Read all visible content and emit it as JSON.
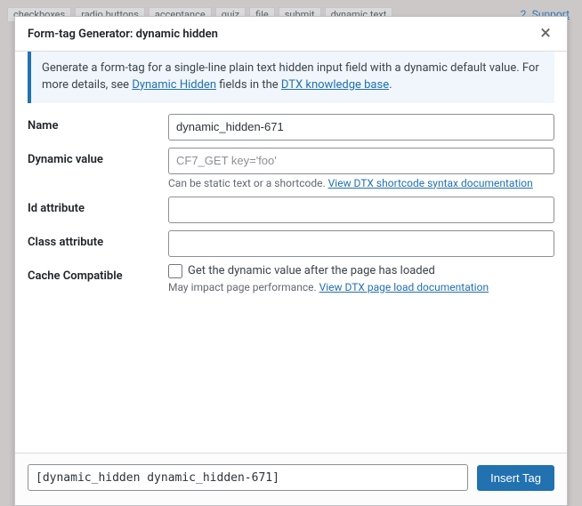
{
  "bg": {
    "tabs": [
      "checkboxes",
      "radio buttons",
      "acceptance",
      "quiz",
      "file",
      "submit",
      "dynamic text"
    ],
    "support_link": "2. Support"
  },
  "modal": {
    "title": "Form-tag Generator: dynamic hidden",
    "notice": {
      "text_before": "Generate a form-tag for a single-line plain text hidden input field with a dynamic default value. For more details, see ",
      "link1": "Dynamic Hidden",
      "text_mid": " fields in the ",
      "link2": "DTX knowledge base",
      "text_after": "."
    },
    "fields": {
      "name": {
        "label": "Name",
        "value": "dynamic_hidden-671"
      },
      "dynamic_value": {
        "label": "Dynamic value",
        "placeholder": "CF7_GET key='foo'",
        "help_text": "Can be static text or a shortcode. ",
        "help_link": "View DTX shortcode syntax documentation"
      },
      "id_attr": {
        "label": "Id attribute"
      },
      "class_attr": {
        "label": "Class attribute"
      },
      "cache": {
        "label": "Cache Compatible",
        "checkbox_label": "Get the dynamic value after the page has loaded",
        "help_text": "May impact page performance. ",
        "help_link": "View DTX page load documentation"
      }
    },
    "output": "[dynamic_hidden dynamic_hidden-671]",
    "insert_label": "Insert Tag"
  }
}
